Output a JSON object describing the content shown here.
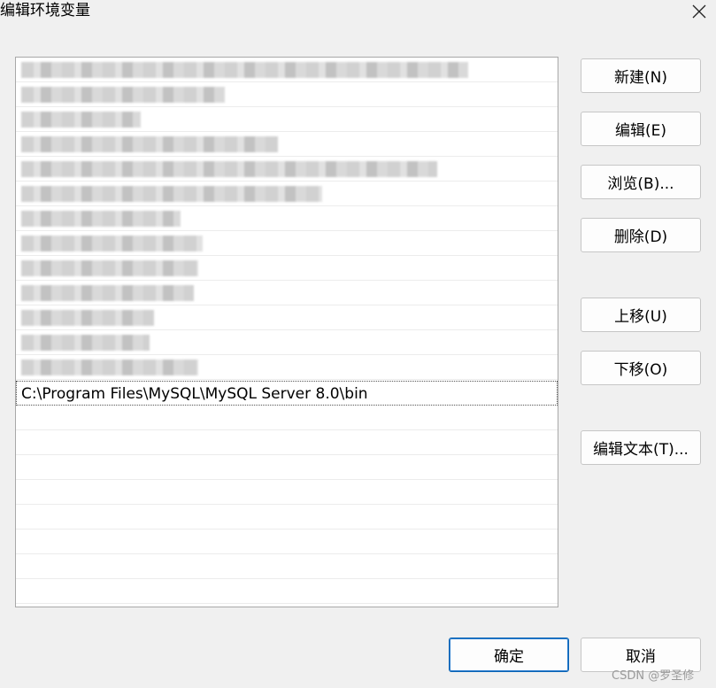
{
  "window": {
    "title": "编辑环境变量"
  },
  "path_list": {
    "visible_entry": "C:\\Program Files\\MySQL\\MySQL Server 8.0\\bin"
  },
  "buttons": {
    "new": "新建(N)",
    "edit": "编辑(E)",
    "browse": "浏览(B)...",
    "delete": "删除(D)",
    "move_up": "上移(U)",
    "move_down": "下移(O)",
    "edit_text": "编辑文本(T)...",
    "ok": "确定",
    "cancel": "取消"
  },
  "watermark": "CSDN @罗圣修"
}
